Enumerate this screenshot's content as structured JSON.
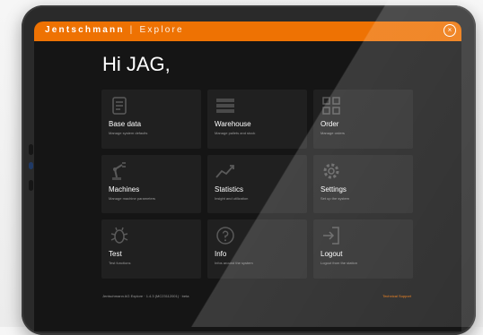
{
  "topbar": {
    "brand": "Jentschmann",
    "separator": "|",
    "product": "Explore",
    "close_symbol": "×"
  },
  "greeting": "Hi JAG,",
  "tiles": [
    {
      "label": "Base data",
      "sub": "Manage system defaults",
      "icon": "document-icon"
    },
    {
      "label": "Warehouse",
      "sub": "Manage pallets and stock",
      "icon": "shelves-icon"
    },
    {
      "label": "Order",
      "sub": "Manage orders",
      "icon": "grid-icon"
    },
    {
      "label": "Machines",
      "sub": "Manage machine parameters",
      "icon": "robot-arm-icon"
    },
    {
      "label": "Statistics",
      "sub": "Insight and utilization",
      "icon": "chart-icon"
    },
    {
      "label": "Settings",
      "sub": "Set up the system",
      "icon": "gear-icon"
    },
    {
      "label": "Test",
      "sub": "Test functions",
      "icon": "bug-icon"
    },
    {
      "label": "Info",
      "sub": "Infos around the system",
      "icon": "question-icon"
    },
    {
      "label": "Logout",
      "sub": "Logout from the station",
      "icon": "logout-icon"
    }
  ],
  "footer": {
    "version": "Jentschmann AG Explore · 1.4.3 (MC23112001) · beta",
    "support": "Technical Support"
  },
  "colors": {
    "accent": "#ee7203",
    "background": "#151515",
    "tile": "#202020"
  }
}
